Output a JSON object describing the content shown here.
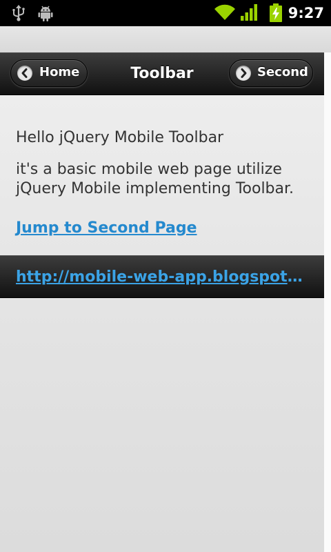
{
  "status_bar": {
    "time": "9:27",
    "icons": [
      "usb-icon",
      "android-debug-icon",
      "wifi-icon",
      "signal-icon",
      "battery-charging-icon"
    ]
  },
  "header": {
    "title": "Toolbar",
    "left_button": {
      "label": "Home",
      "icon": "chevron-left-icon"
    },
    "right_button": {
      "label": "Second",
      "icon": "chevron-right-icon"
    }
  },
  "content": {
    "greeting": "Hello jQuery Mobile Toolbar",
    "description": "it's a basic mobile web page utilize jQuery Mobile implementing Toolbar.",
    "link_text": "Jump to Second Page"
  },
  "footer": {
    "link_text": "http://mobile-web-app.blogspot.com/"
  },
  "colors": {
    "link": "#2489ce",
    "footer_link": "#3ba3e6",
    "bar_dark": "#111111",
    "status_green": "#9bd300"
  }
}
